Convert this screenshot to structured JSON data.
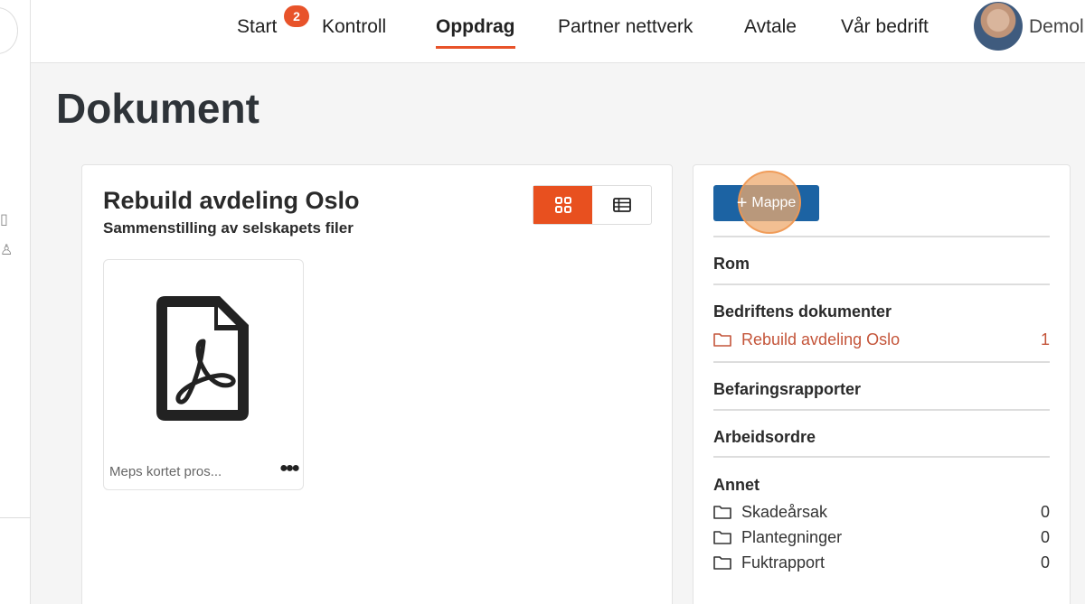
{
  "nav": {
    "items": [
      {
        "label": "Start",
        "badge": "2"
      },
      {
        "label": "Kontroll"
      },
      {
        "label": "Oppdrag",
        "active": true
      },
      {
        "label": "Partner nettverk"
      },
      {
        "label": "Avtale"
      },
      {
        "label": "Vår bedrift"
      }
    ],
    "user_name": "Demol"
  },
  "page": {
    "title": "Dokument"
  },
  "folder_view": {
    "title": "Rebuild avdeling Oslo",
    "subtitle": "Sammenstilling av selskapets filer",
    "view_mode": "grid",
    "files": [
      {
        "name": "Meps kortet pros...",
        "icon": "pdf-icon"
      }
    ]
  },
  "sidebar": {
    "add_button_label": "Mappe",
    "categories": {
      "rom": "Rom",
      "bedrift": "Bedriftens dokumenter",
      "befaring": "Befaringsrapporter",
      "arbeid": "Arbeidsordre",
      "annet": "Annet"
    },
    "folders": {
      "rebuild": {
        "name": "Rebuild avdeling Oslo",
        "count": "1"
      },
      "skade": {
        "name": "Skadeårsak",
        "count": "0"
      },
      "plan": {
        "name": "Plantegninger",
        "count": "0"
      },
      "fukt": {
        "name": "Fuktrapport",
        "count": "0"
      }
    }
  },
  "colors": {
    "accent": "#e8532a",
    "primary_button": "#1c63a3",
    "active_folder": "#c4553a"
  }
}
